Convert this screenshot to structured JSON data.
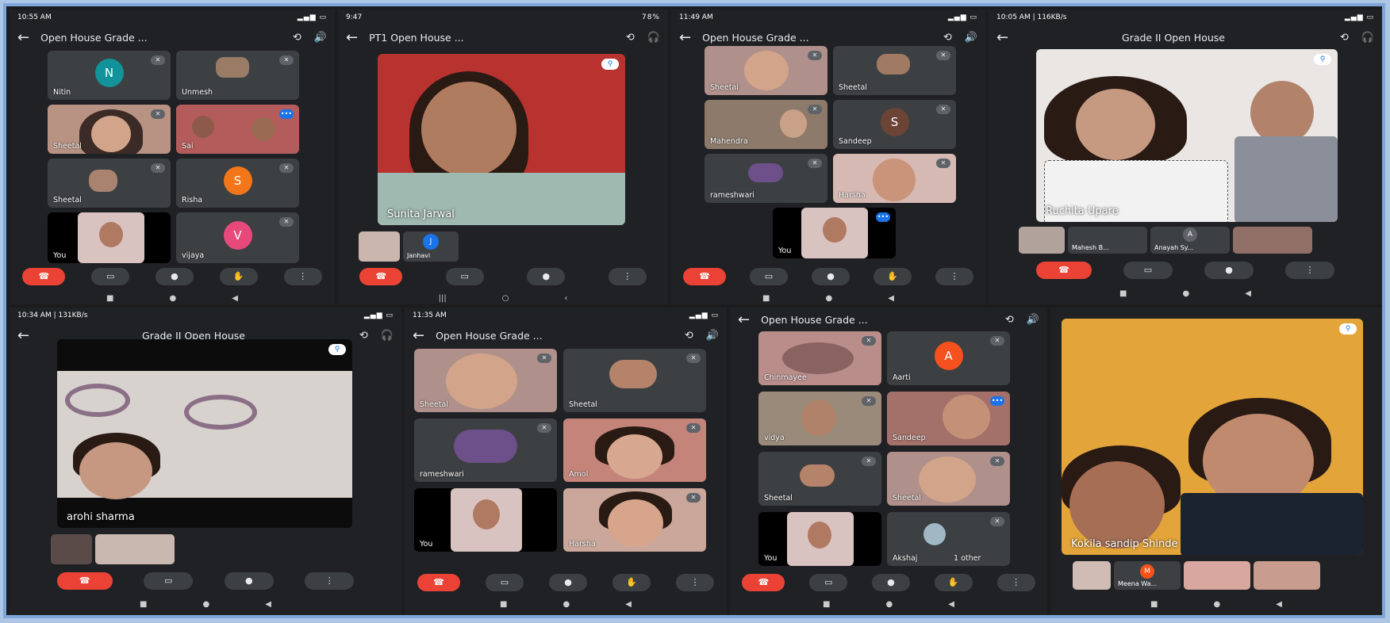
{
  "p1": {
    "time": "10:55 AM",
    "title": "Open House Grade ...",
    "tiles": [
      "Nitin",
      "Unmesh",
      "Sheetal",
      "Sai",
      "Sheetal",
      "Risha",
      "You",
      "vijaya"
    ],
    "avatars": {
      "nitin": "N",
      "risha": "S",
      "vijaya": "V"
    }
  },
  "p2": {
    "time": "9:47",
    "battery": "78%",
    "title": "PT1 Open House ...",
    "main": "Sunita Jarwal",
    "thumb": "Janhavi",
    "thumb_av": "J"
  },
  "p3": {
    "time": "11:49 AM",
    "title": "Open House Grade ...",
    "tiles": [
      "Sheetal",
      "Sheetal",
      "Mahendra",
      "Sandeep",
      "rameshwari",
      "Harsha",
      "You"
    ],
    "avatars": {
      "sandeep": "S"
    }
  },
  "p4": {
    "time": "10:05 AM | 116KB/s",
    "title": "Grade II Open House",
    "main": "Ruchita Upare",
    "thumbs": [
      "Mahesh B...",
      "Anayah Sy..."
    ],
    "thumb_av": "A"
  },
  "p5": {
    "time": "10:34 AM | 131KB/s",
    "title": "Grade II Open House",
    "main": "arohi sharma"
  },
  "p6": {
    "time": "11:35 AM",
    "title": "Open House Grade ...",
    "tiles": [
      "Sheetal",
      "Sheetal",
      "rameshwari",
      "Amol",
      "You",
      "Harsha"
    ]
  },
  "p7": {
    "title": "Open House Grade ...",
    "tiles": [
      "Chinmayee",
      "Aarti",
      "vidya",
      "Sandeep",
      "Sheetal",
      "Sheetal",
      "You",
      "Akshaj"
    ],
    "avatars": {
      "aarti": "A"
    },
    "other": "1 other"
  },
  "p8": {
    "main": "Kokila sandip Shinde",
    "thumb": "Meena Wa...",
    "thumb_av": "M"
  },
  "colors": {
    "end": "#ea4335",
    "bg": "#202124",
    "tile": "#3c4043",
    "accent": "#1a73e8"
  }
}
